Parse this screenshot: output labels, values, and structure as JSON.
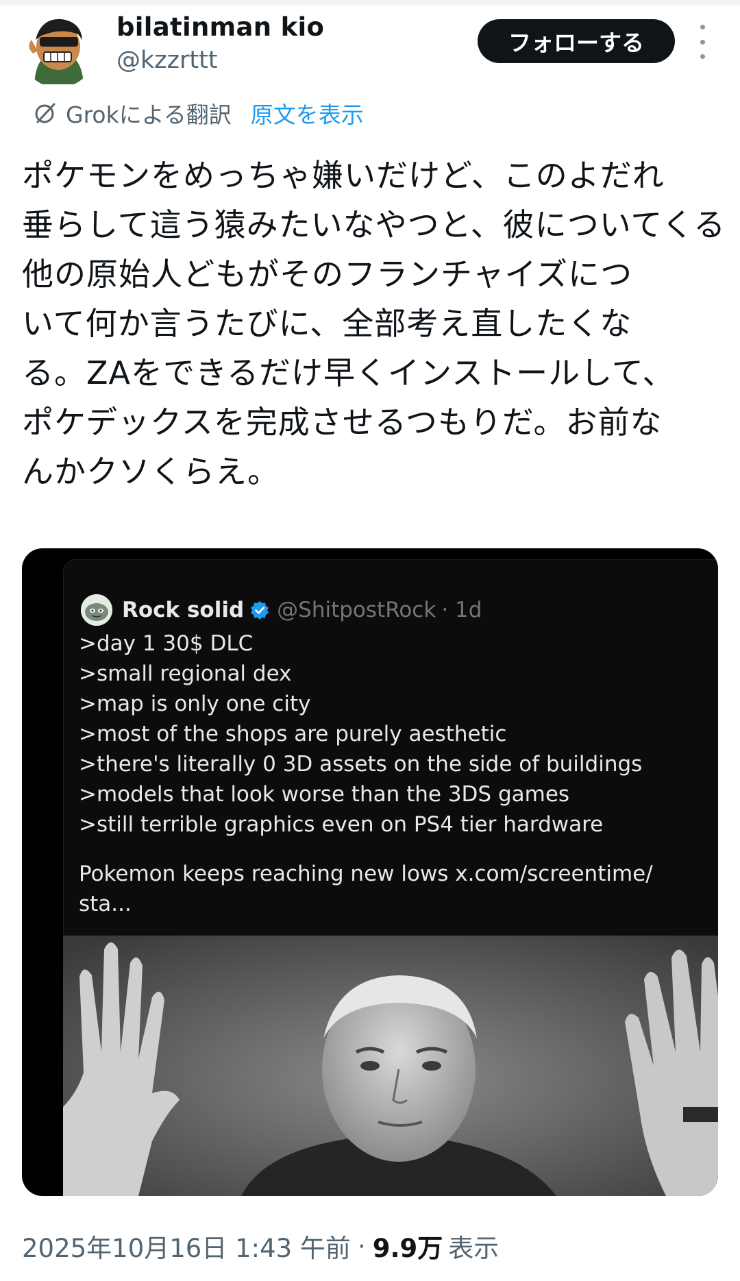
{
  "author": {
    "display_name": "bilatinman kio",
    "handle": "@kzzrttt",
    "follow_label": "フォローする"
  },
  "translation": {
    "label": "Grokによる翻訳",
    "show_original": "原文を表示"
  },
  "tweet": {
    "lines": [
      "ポケモンをめっちゃ嫌いだけど、このよだれ",
      "垂らして這う猿みたいなやつと、彼についてくる",
      "他の原始人どもがそのフランチャイズにつ",
      "いて何か言うたびに、全部考え直したくな",
      "る。ZAをできるだけ早くインストールして、",
      "ポケデックスを完成させるつもりだ。お前な",
      "んかクソくらえ。"
    ]
  },
  "quoted": {
    "name": "Rock solid",
    "handle": "@ShitpostRock",
    "time": "· 1d",
    "lines": [
      ">day 1 30$ DLC",
      ">small regional dex",
      ">map is only one city",
      ">most of the shops are purely aesthetic",
      ">there's literally 0 3D assets on the side of buildings",
      ">models that look worse than the 3DS games",
      ">still terrible graphics even on PS4 tier hardware"
    ],
    "closing_lines": [
      "Pokemon keeps reaching new lows x.com/screentime/",
      "sta..."
    ]
  },
  "footer": {
    "date": "2025年10月16日 1:43 午前",
    "separator": "·",
    "views_count": "9.9万",
    "views_label": "表示"
  },
  "colors": {
    "text": "#0f1419",
    "muted": "#536471",
    "link": "#1d9bf0",
    "follow_bg": "#0f1419",
    "verified": "#1d9bf0",
    "card_bg": "#000000"
  },
  "icons": {
    "grok": "grok-icon",
    "verified": "verified-badge-icon",
    "more": "more-options-icon"
  }
}
